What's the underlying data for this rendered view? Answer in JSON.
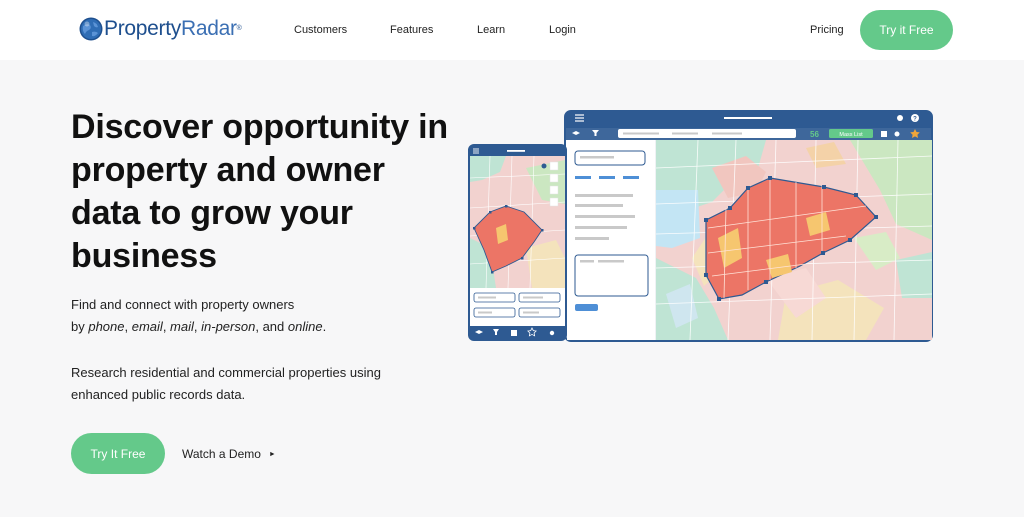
{
  "brand": {
    "name_part1": "Property",
    "name_part2": "Radar",
    "tm": "®"
  },
  "nav": {
    "customers": "Customers",
    "features": "Features",
    "learn": "Learn",
    "login": "Login",
    "pricing": "Pricing",
    "cta": "Try it Free"
  },
  "hero": {
    "headline": "Discover opportunity in property and owner data to grow your business",
    "para1": {
      "line1": "Find and connect with property owners",
      "by": "by ",
      "phone": "phone",
      "email": "email",
      "mail": "mail",
      "in_person": "in-person",
      "and": "and",
      "online": "online",
      "comma": ", ",
      "period": "."
    },
    "para2": {
      "line1": "Research residential and commercial properties using",
      "line2": "enhanced public records data."
    },
    "cta": "Try It Free",
    "demo": "Watch a Demo",
    "demo_arrow": "►"
  },
  "illustration": {
    "count_badge": "56",
    "list_button": "Mass List"
  },
  "colors": {
    "accent_green": "#64c98a",
    "brand_blue": "#1e4f8e",
    "app_bar": "#2e5a92",
    "map_highlight": "#ec7566"
  }
}
